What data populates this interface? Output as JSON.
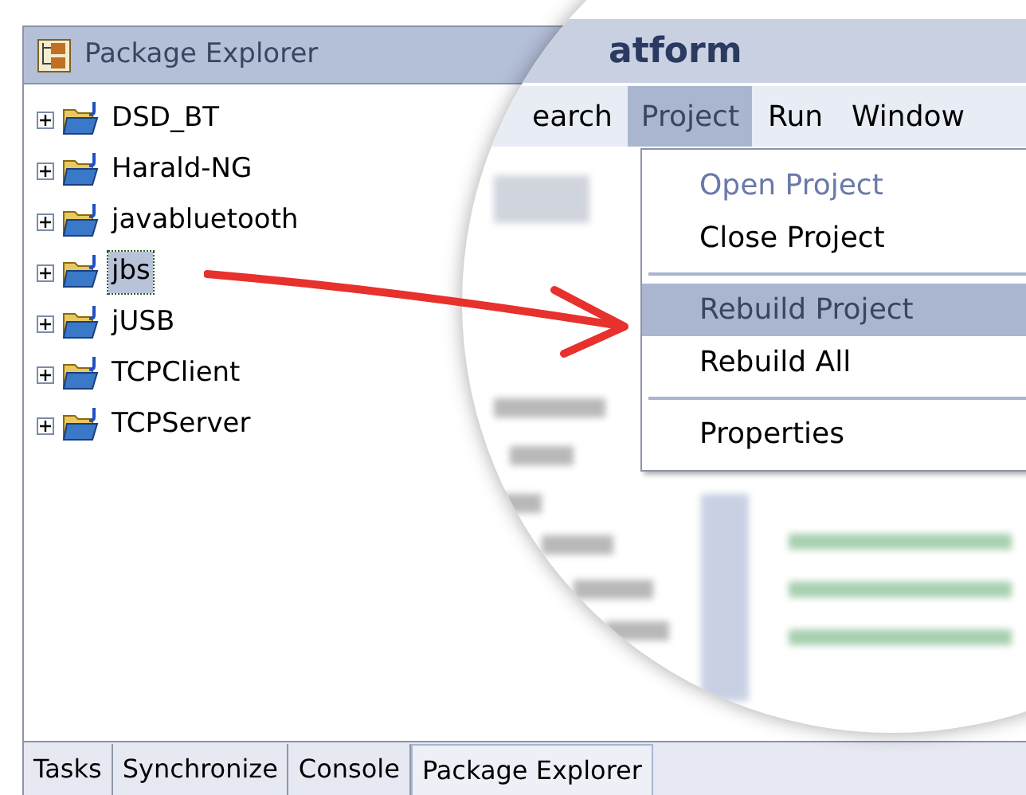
{
  "panel": {
    "title": "Package Explorer"
  },
  "tree": [
    {
      "label": "DSD_BT",
      "expanded": false,
      "selected": false
    },
    {
      "label": "Harald-NG",
      "expanded": false,
      "selected": false
    },
    {
      "label": "javabluetooth",
      "expanded": false,
      "selected": false
    },
    {
      "label": "jbs",
      "expanded": false,
      "selected": true
    },
    {
      "label": "jUSB",
      "expanded": false,
      "selected": false
    },
    {
      "label": "TCPClient",
      "expanded": false,
      "selected": false
    },
    {
      "label": "TCPServer",
      "expanded": false,
      "selected": false
    }
  ],
  "magnifier": {
    "title_fragment": "atform",
    "menu_bar": [
      {
        "label": "earch",
        "selected": false
      },
      {
        "label": "Project",
        "selected": true
      },
      {
        "label": "Run",
        "selected": false
      },
      {
        "label": "Window",
        "selected": false
      }
    ],
    "menu": [
      {
        "kind": "item",
        "label": "Open Project",
        "disabled": true,
        "selected": false
      },
      {
        "kind": "item",
        "label": "Close Project",
        "disabled": false,
        "selected": false
      },
      {
        "kind": "separator"
      },
      {
        "kind": "item",
        "label": "Rebuild Project",
        "disabled": false,
        "selected": true
      },
      {
        "kind": "item",
        "label": "Rebuild All",
        "disabled": false,
        "selected": false
      },
      {
        "kind": "separator"
      },
      {
        "kind": "item",
        "label": "Properties",
        "disabled": false,
        "selected": false
      }
    ]
  },
  "bottom_tabs": [
    {
      "label": "Tasks",
      "selected": false
    },
    {
      "label": "Synchronize",
      "selected": false
    },
    {
      "label": "Console",
      "selected": false
    },
    {
      "label": "Package Explorer",
      "selected": true
    }
  ]
}
